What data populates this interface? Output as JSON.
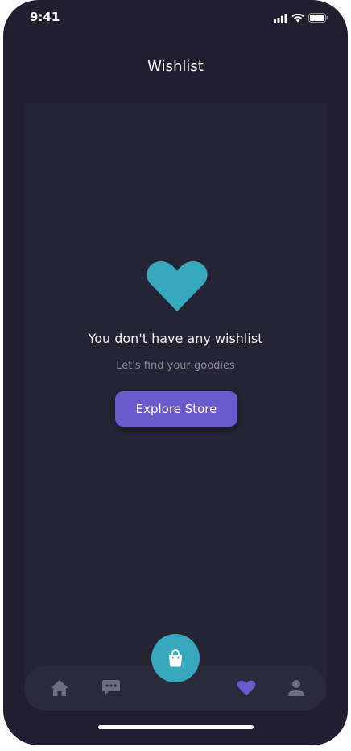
{
  "status": {
    "time": "9:41"
  },
  "header": {
    "title": "Wishlist"
  },
  "empty_state": {
    "title": "You don't have any wishlist",
    "subtitle": "Let's find your goodies",
    "button_label": "Explore Store",
    "icon": "heart-icon"
  },
  "tab_bar": {
    "items": [
      {
        "icon": "home-icon",
        "active": false
      },
      {
        "icon": "chat-icon",
        "active": false
      },
      {
        "icon": "shopping-bag-icon",
        "active": false,
        "center": true
      },
      {
        "icon": "heart-icon",
        "active": true
      },
      {
        "icon": "profile-icon",
        "active": false
      }
    ]
  },
  "colors": {
    "background": "#201e2f",
    "content": "#252435",
    "accent_teal": "#37a8bd",
    "accent_purple": "#6a5acd",
    "inactive_icon": "#6e6e80"
  }
}
